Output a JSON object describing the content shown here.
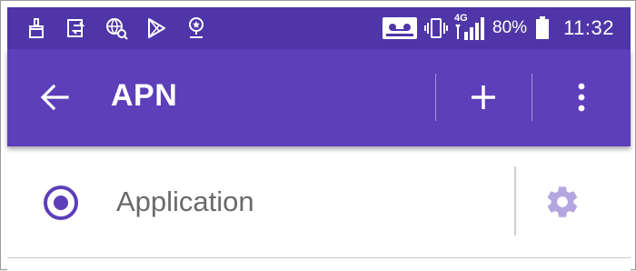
{
  "status_bar": {
    "left_icons": [
      "cleaner-icon",
      "data-transfer-icon",
      "web-search-icon",
      "play-store-icon",
      "location-pin-icon"
    ],
    "right_icons": [
      "voicemail-icon",
      "vibrate-icon",
      "signal-4g-icon",
      "battery-icon"
    ],
    "network_label": "4G",
    "battery_percent": "80%",
    "time": "11:32"
  },
  "app_bar": {
    "title": "APN",
    "back_icon": "arrow-back-icon",
    "add_icon": "plus-icon",
    "more_icon": "more-vertical-icon"
  },
  "apn_list": [
    {
      "label": "Application",
      "selected": true
    }
  ],
  "colors": {
    "status_bar": "#4e36a8",
    "app_bar": "#5c3fb9",
    "accent": "#5c3fb9",
    "settings_icon": "#b4a6e0",
    "label_text": "#6a6a6a"
  }
}
